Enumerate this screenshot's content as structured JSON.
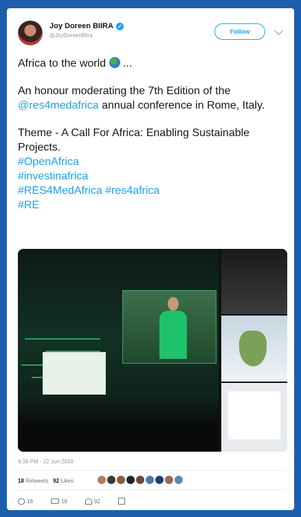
{
  "author": {
    "name": "Joy Doreen BIIRA",
    "handle": "@JoyDoreenBiira",
    "follow_label": "Follow"
  },
  "tweet": {
    "line1": "Africa to the world ",
    "line1_tail": " ...",
    "p2_a": "An honour moderating the 7th Edition of the ",
    "p2_mention": "@res4medafrica",
    "p2_b": " annual conference in Rome, Italy.",
    "p3": "Theme - A Call For Africa: Enabling Sustainable Projects.",
    "hashtags": [
      "#OpenAfrica",
      "#investinafrica",
      "#RES4MedAfrica #res4africa",
      "#RE"
    ]
  },
  "meta": {
    "timestamp": "6:36 PM - 22 Jun 2018",
    "retweets_count": "18",
    "retweets_label": "Retweets",
    "likes_count": "92",
    "likes_label": "Likes"
  },
  "actions": {
    "reply_count": "16",
    "retweet_count": "18",
    "like_count": "92"
  },
  "colors": {
    "background": "#1d5fae",
    "link": "#1da1f2",
    "verified": "#1da1f2"
  }
}
